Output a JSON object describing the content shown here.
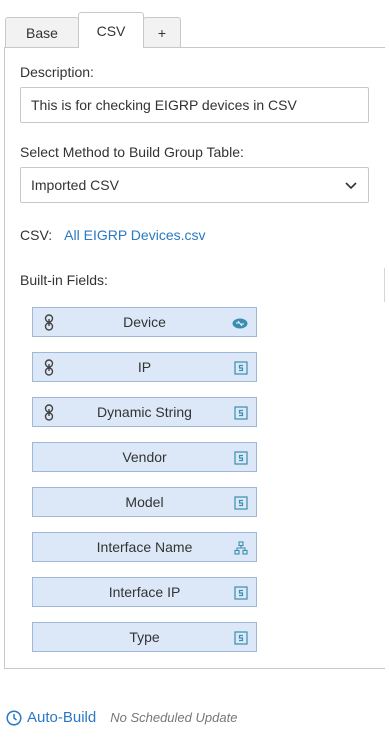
{
  "tabs": [
    {
      "label": "Base",
      "active": false
    },
    {
      "label": "CSV",
      "active": true
    },
    {
      "label": "+",
      "active": false
    }
  ],
  "description": {
    "label": "Description:",
    "value": "This is for checking EIGRP devices in CSV"
  },
  "method": {
    "label": "Select Method to Build Group Table:",
    "selected": "Imported CSV"
  },
  "csv": {
    "label": "CSV:",
    "file": "All EIGRP Devices.csv"
  },
  "builtin": {
    "label": "Built-in Fields:",
    "fields": [
      {
        "name": "Device",
        "linked": true,
        "type_icon": "device-icon"
      },
      {
        "name": "IP",
        "linked": true,
        "type_icon": "string-icon"
      },
      {
        "name": "Dynamic String",
        "linked": true,
        "type_icon": "string-icon"
      },
      {
        "name": "Vendor",
        "linked": false,
        "type_icon": "string-icon"
      },
      {
        "name": "Model",
        "linked": false,
        "type_icon": "string-icon"
      },
      {
        "name": "Interface Name",
        "linked": false,
        "type_icon": "hierarchy-icon"
      },
      {
        "name": "Interface IP",
        "linked": false,
        "type_icon": "string-icon"
      },
      {
        "name": "Type",
        "linked": false,
        "type_icon": "string-icon"
      }
    ]
  },
  "autobuild": {
    "label": "Auto-Build",
    "status": "No Scheduled Update"
  },
  "colors": {
    "accent": "#2a79c2",
    "field_bg": "#dce8f8",
    "field_border": "#9fb8d8",
    "icon": "#3a8fb0"
  }
}
